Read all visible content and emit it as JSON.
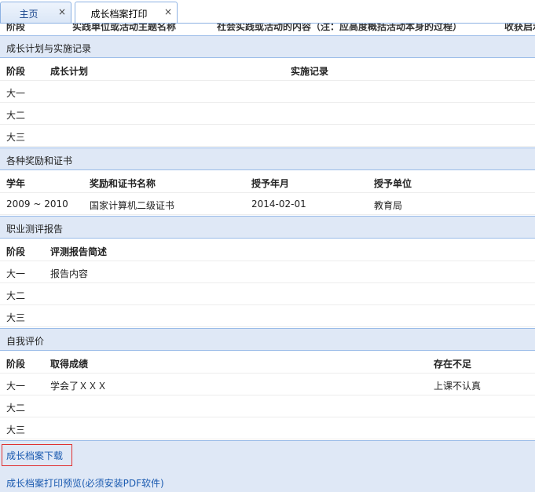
{
  "tabs": [
    {
      "label": "主页",
      "close": "×"
    },
    {
      "label": "成长档案打印",
      "close": "×"
    }
  ],
  "top_clipped_header": [
    "阶段",
    "实践单位或活动主题名称",
    "社会实践或活动的内容（注：应高度概括活动本身的过程）",
    "收获启示"
  ],
  "growth_plan": {
    "title": "成长计划与实施记录",
    "headers": [
      "阶段",
      "成长计划",
      "实施记录"
    ],
    "rows": [
      [
        "大一",
        "",
        ""
      ],
      [
        "大二",
        "",
        ""
      ],
      [
        "大三",
        "",
        ""
      ]
    ]
  },
  "awards": {
    "title": "各种奖励和证书",
    "headers": [
      "学年",
      "奖励和证书名称",
      "授予年月",
      "授予单位"
    ],
    "rows": [
      [
        "2009 ~ 2010",
        "国家计算机二级证书",
        "2014-02-01",
        "教育局"
      ]
    ]
  },
  "career_report": {
    "title": "职业测评报告",
    "headers": [
      "阶段",
      "评测报告简述"
    ],
    "rows": [
      [
        "大一",
        "报告内容"
      ],
      [
        "大二",
        ""
      ],
      [
        "大三",
        ""
      ]
    ]
  },
  "self_eval": {
    "title": "自我评价",
    "headers": [
      "阶段",
      "取得成绩",
      "存在不足"
    ],
    "rows": [
      [
        "大一",
        "学会了ＸＸＸ",
        "上课不认真"
      ],
      [
        "大二",
        "",
        ""
      ],
      [
        "大三",
        "",
        ""
      ]
    ]
  },
  "footer": {
    "download_link": "成长档案下载",
    "preview_link": "成长档案打印预览(必须安装PDF软件)"
  },
  "colors": {
    "section_bg": "#dfe8f6",
    "border": "#99bbe8",
    "link": "#1a5ab0",
    "highlight_box": "#e03030"
  }
}
